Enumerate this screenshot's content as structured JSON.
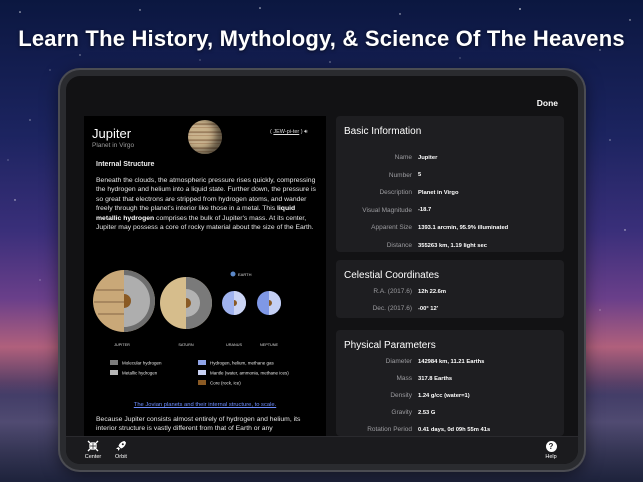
{
  "hero": {
    "title": "Learn The History, Mythology, & Science Of The Heavens"
  },
  "top": {
    "done_label": "Done"
  },
  "article": {
    "planet_name": "Jupiter",
    "planet_subtitle": "Planet in Virgo",
    "pronunciation": "JEW-pi-ter",
    "section_heading": "Internal Structure",
    "para1_part1": "Beneath the clouds, the atmospheric pressure rises quickly, compressing the hydrogen and helium into a liquid state. Further down, the pressure is so great that electrons are stripped from hydrogen atoms, and wander freely through the planet's interior like those in a metal. This ",
    "para1_bold": "liquid metallic hydrogen",
    "para1_part2": " comprises the bulk of Jupiter's mass. At its center, Jupiter may possess a core of rocky material about the size of the Earth.",
    "diagram": {
      "planet_labels": [
        "JUPITER",
        "SATURN",
        "URANUS",
        "NEPTUNE"
      ],
      "earth_label": "EARTH",
      "legend": [
        {
          "label": "Molecular hydrogen",
          "color": "#7d7d7d"
        },
        {
          "label": "Metallic hydrogen",
          "color": "#b7b7b7"
        },
        {
          "label": "Hydrogen, helium, methane gas",
          "color": "#8fa4e8"
        },
        {
          "label": "Mantle (water, ammonia, methane ices)",
          "color": "#c9d2f4"
        },
        {
          "label": "Core (rock, ice)",
          "color": "#8a5a24"
        }
      ]
    },
    "caption_link": "The Jovian planets and their internal structure, to scale.",
    "para2": "Because Jupiter consists almost entirely of hydrogen and helium, its interior structure is vastly different from that of Earth or any"
  },
  "basic_info": {
    "title": "Basic Information",
    "rows": [
      {
        "label": "Name",
        "value": "Jupiter"
      },
      {
        "label": "Number",
        "value": "5"
      },
      {
        "label": "Description",
        "value": "Planet in Virgo"
      },
      {
        "label": "Visual Magnitude",
        "value": "-18.7"
      },
      {
        "label": "Apparent Size",
        "value": "1393.1 arcmin, 95.9% illuminated"
      },
      {
        "label": "Distance",
        "value": "355263 km, 1.19 light sec"
      }
    ]
  },
  "celestial": {
    "title": "Celestial Coordinates",
    "rows": [
      {
        "label": "R.A. (2017.6)",
        "value": "12h 22.6m"
      },
      {
        "label": "Dec. (2017.6)",
        "value": "-00° 12'"
      }
    ]
  },
  "physical": {
    "title": "Physical Parameters",
    "rows": [
      {
        "label": "Diameter",
        "value": "142984 km, 11.21 Earths"
      },
      {
        "label": "Mass",
        "value": "317.8 Earths"
      },
      {
        "label": "Density",
        "value": "1.24 g/cc (water=1)"
      },
      {
        "label": "Gravity",
        "value": "2.53 G"
      },
      {
        "label": "Rotation Period",
        "value": "0.41 days, 0d 09h 55m 41s"
      }
    ]
  },
  "toolbar": {
    "center_label": "Center",
    "orbit_label": "Orbit",
    "help_label": "Help",
    "help_glyph": "?"
  }
}
